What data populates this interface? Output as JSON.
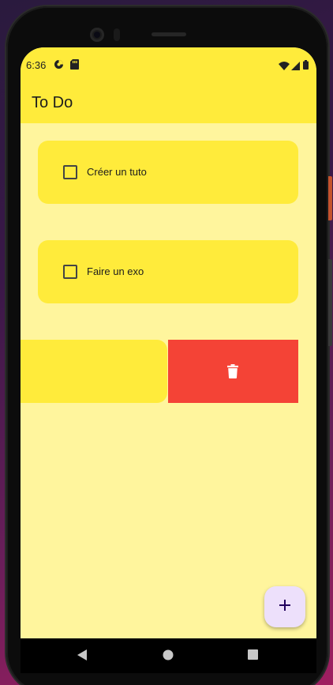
{
  "status_bar": {
    "time": "6:36",
    "left_icons": [
      "data-saver-icon",
      "sd-card-icon"
    ],
    "right_icons": [
      "wifi-icon",
      "cell-signal-icon",
      "battery-icon"
    ]
  },
  "app_bar": {
    "title": "To Do"
  },
  "todos": [
    {
      "label": "Créer un tuto",
      "checked": false
    },
    {
      "label": "Faire un exo",
      "checked": false
    }
  ],
  "swiped_item": {
    "action_icon": "trash-icon"
  },
  "fab": {
    "icon": "plus-icon"
  },
  "nav": {
    "buttons": [
      "back-icon",
      "home-icon",
      "recents-icon"
    ]
  },
  "colors": {
    "app_bar": "#ffeb3b",
    "background": "#fff59d",
    "card": "#ffeb3b",
    "delete": "#f44336",
    "fab": "#ede0fb"
  }
}
